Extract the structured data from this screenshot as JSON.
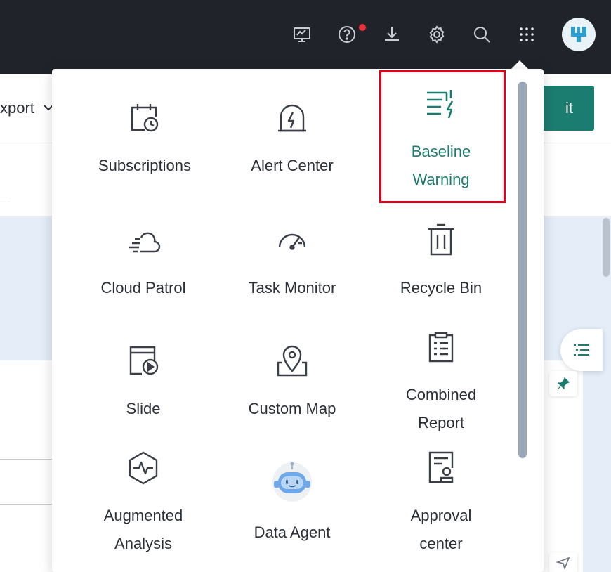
{
  "topbar": {
    "icons": [
      "monitor-chart-icon",
      "help-icon",
      "download-icon",
      "settings-gear-icon",
      "search-icon",
      "app-grid-icon"
    ],
    "notification_dot_color": "#e8313b",
    "avatar_icon": "user-logo-icon"
  },
  "background": {
    "export_label": "xport",
    "primary_button_label": "it",
    "accent_color": "#1b7d6f"
  },
  "apps_menu": {
    "items": [
      {
        "label": "Subscriptions",
        "icon": "calendar-clock-icon"
      },
      {
        "label": "Alert Center",
        "icon": "alarm-light-icon"
      },
      {
        "label": "Baseline\nWarning",
        "icon": "baseline-warning-icon",
        "active": true
      },
      {
        "label": "Cloud Patrol",
        "icon": "cloud-patrol-icon"
      },
      {
        "label": "Task Monitor",
        "icon": "gauge-icon"
      },
      {
        "label": "Recycle Bin",
        "icon": "trash-icon"
      },
      {
        "label": "Slide",
        "icon": "slide-play-icon"
      },
      {
        "label": "Custom Map",
        "icon": "map-pin-icon"
      },
      {
        "label": "Combined\nReport",
        "icon": "clipboard-report-icon"
      },
      {
        "label": "Augmented\nAnalysis",
        "icon": "hexagon-pulse-icon"
      },
      {
        "label": "Data Agent",
        "icon": "robot-agent-icon"
      },
      {
        "label": "Approval\ncenter",
        "icon": "approval-document-icon"
      }
    ],
    "active_color": "#1b7d6f",
    "highlight_color": "#e0001b"
  }
}
